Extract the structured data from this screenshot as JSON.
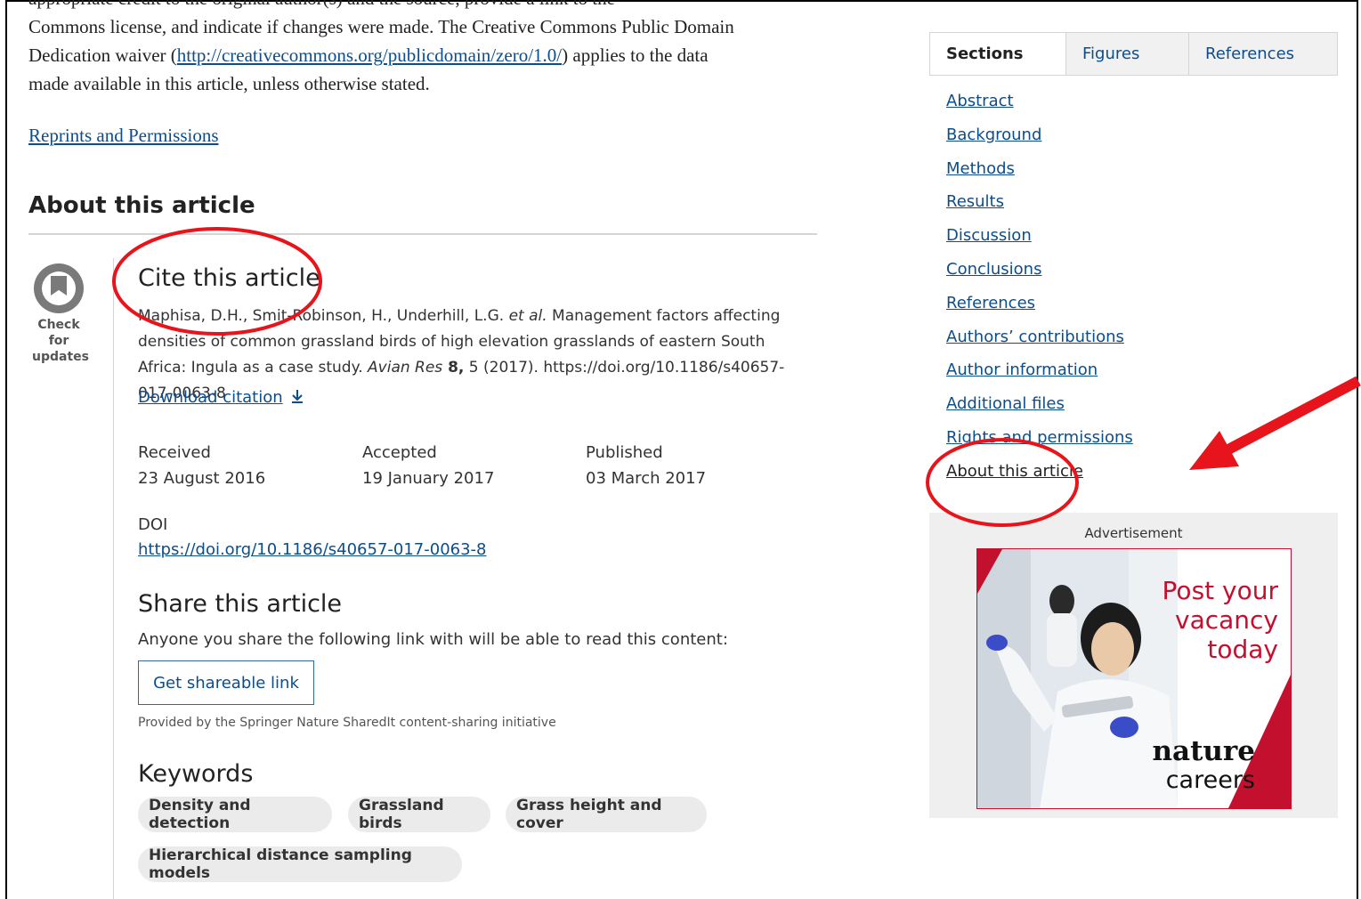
{
  "license": {
    "cut_line": "appropriate credit to the original author(s) and the source, provide a link to the",
    "line1": "Commons license, and indicate if changes were made. The Creative Commons Public Domain",
    "line2_pre": "Dedication waiver (",
    "line2_link": "http://creativecommons.org/publicdomain/zero/1.0/",
    "line2_post": ") applies to the data",
    "line3": "made available in this article, unless otherwise stated."
  },
  "reprints_link": "Reprints and Permissions",
  "about": {
    "heading": "About this article",
    "check_updates": "Check for updates",
    "cite_heading": "Cite this article",
    "citation": {
      "authors": "Maphisa, D.H., Smit-Robinson, H., Underhill, L.G. ",
      "et_al": "et al.",
      "title": " Management factors affecting densities of common grassland birds of high elevation grasslands of eastern South Africa: Ingula as a case study. ",
      "journal": "Avian Res",
      "volume": " 8,",
      "rest": " 5 (2017). https://doi.org/10.1186/s40657-017-0063-8"
    },
    "download_citation": "Download citation",
    "received_label": "Received",
    "received_date": "23 August 2016",
    "accepted_label": "Accepted",
    "accepted_date": "19 January 2017",
    "published_label": "Published",
    "published_date": "03 March 2017",
    "doi_label": "DOI",
    "doi_link": "https://doi.org/10.1186/s40657-017-0063-8",
    "share_heading": "Share this article",
    "share_text": "Anyone you share the following link with will be able to read this content:",
    "share_button": "Get shareable link",
    "provided_by": "Provided by the Springer Nature SharedIt content-sharing initiative",
    "keywords_heading": "Keywords",
    "keywords": [
      "Density and detection",
      "Grassland birds",
      "Grass height and cover",
      "Hierarchical distance sampling models"
    ]
  },
  "sidebar": {
    "tabs": [
      "Sections",
      "Figures",
      "References"
    ],
    "toc": [
      "Abstract",
      "Background",
      "Methods",
      "Results",
      "Discussion",
      "Conclusions",
      "References",
      "Authors’ contributions",
      "Author information",
      "Additional files",
      "Rights and permissions",
      "About this article"
    ]
  },
  "ad": {
    "label": "Advertisement",
    "line1": "Post your",
    "line2": "vacancy",
    "line3": "today",
    "brand1": "nature",
    "brand2": "careers"
  },
  "colors": {
    "link": "#0c4d8c",
    "annotation_red": "#e8141b",
    "ad_red": "#c3102f"
  }
}
